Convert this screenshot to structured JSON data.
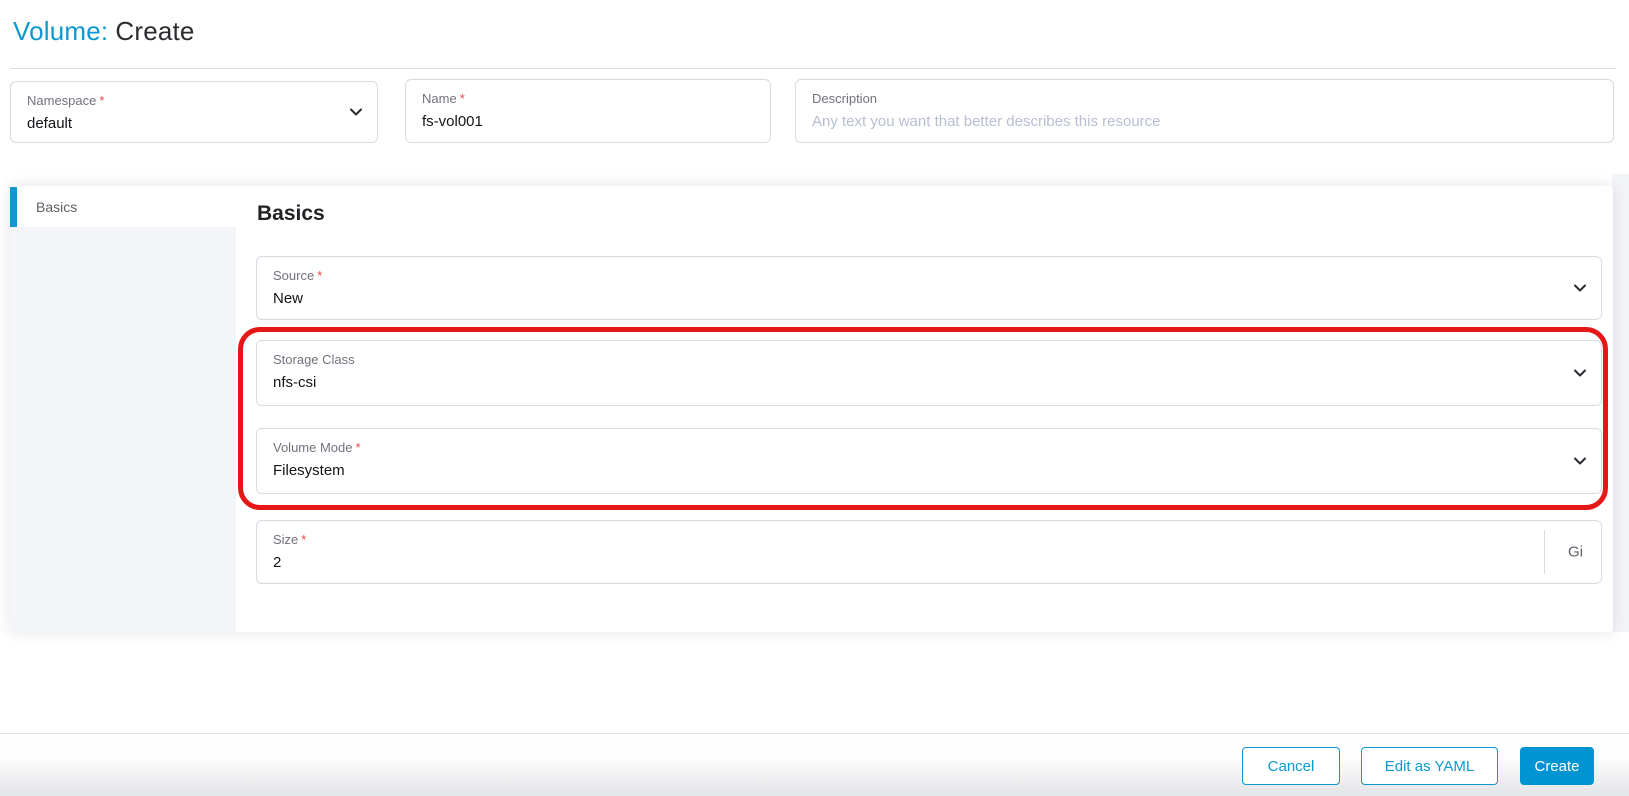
{
  "page": {
    "title_prefix": "Volume:",
    "title_suffix": "Create",
    "required_marker": "*"
  },
  "colors": {
    "accent": "#0d98d0",
    "annotation_red": "#e61717",
    "sidebar_bg": "#f4f5f9",
    "field_border": "#d8dbe3"
  },
  "header_fields": {
    "namespace": {
      "label": "Namespace",
      "value": "default"
    },
    "name": {
      "label": "Name",
      "value": "fs-vol001"
    },
    "description": {
      "label": "Description",
      "placeholder": "Any text you want that better describes this resource"
    }
  },
  "sidebar": {
    "tabs": [
      {
        "label": "Basics",
        "active": true
      }
    ]
  },
  "section": {
    "heading": "Basics",
    "fields": {
      "source": {
        "label": "Source",
        "value": "New"
      },
      "storage_class": {
        "label": "Storage Class",
        "value": "nfs-csi"
      },
      "volume_mode": {
        "label": "Volume Mode",
        "value": "Filesystem"
      },
      "size": {
        "label": "Size",
        "value": "2",
        "unit": "Gi"
      }
    }
  },
  "footer": {
    "cancel_label": "Cancel",
    "edit_yaml_label": "Edit as YAML",
    "create_label": "Create"
  }
}
